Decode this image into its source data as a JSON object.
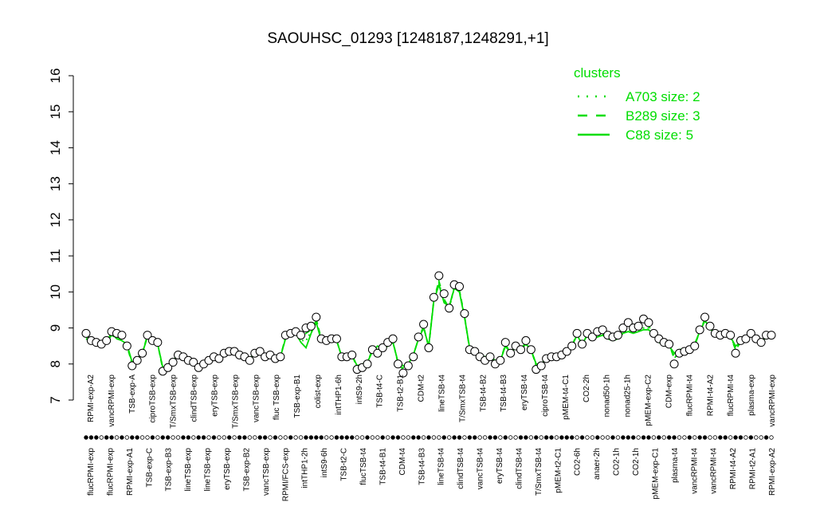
{
  "chart_data": {
    "type": "line",
    "title": "SAOUHSC_01293 [1248187,1248291,+1]",
    "ylim": [
      7,
      16
    ],
    "yticks": [
      "7",
      "8",
      "9",
      "10",
      "11",
      "12",
      "13",
      "14",
      "15",
      "16"
    ],
    "grid": false,
    "legend_position": "top-right",
    "legend": {
      "title": "clusters",
      "color": "#00dd00",
      "entries": [
        {
          "label": "A703 size: 2",
          "style": "dotted"
        },
        {
          "label": "B289 size: 3",
          "style": "dashed"
        },
        {
          "label": "C88 size: 5",
          "style": "solid"
        }
      ]
    },
    "x_labels_upper": [
      "RPMI-exp-A2",
      "vancRPMI-exp",
      "TSB-exp-A",
      "ciproTSB-exp",
      "T/SmxTSB-exp",
      "clindTSB-exp",
      "eryTSB-exp",
      "T/SmxTSB-exp",
      "vancTSB-exp",
      "fluc TSB-exp",
      "TSB-exp-B1",
      "colist-exp",
      "intTHP1-6h",
      "intS9-2h",
      "TSB-t4-C",
      "TSB-t2-B1",
      "CDM-t2",
      "lineTSB-t4",
      "T/SmxTSB-t4",
      "TSB-t4-B2",
      "TSB-t4-B3",
      "eryTSB-t4",
      "ciproTSB-t4",
      "pMEM-t4-C1",
      "CO2-2h",
      "nonad50-1h",
      "nonad25-1h",
      "pMEM-exp-C2",
      "CDM-exp",
      "flucRPMI-t4",
      "RPMI-t4-A2",
      "flucRPMI-t4",
      "plasma-exp",
      "vancRPMI-exp"
    ],
    "x_labels_lower": [
      "flucRPMI-exp",
      "flucRPMI-exp",
      "RPMI-exp-A1",
      "TSB-exp-C",
      "TSB-exp-B3",
      "lineTSB-exp",
      "lineTSB-exp",
      "eryTSB-exp",
      "TSB-exp-B2",
      "vancTSB-exp",
      "RPMI/FCS-exp",
      "intTHP1-2h",
      "intS9-6h",
      "TSB-t2-C",
      "flucTSB-t4",
      "TSB-t4-B1",
      "CDM-t4",
      "TSB-t4-B3",
      "lineTSB-t4",
      "clindTSB-t4",
      "vancTSB-t4",
      "eryTSB-t4",
      "clindTSB-t4",
      "T/SmxTSB-t4",
      "pMEM-t2-C1",
      "CO2-6h",
      "anaer-2h",
      "CO2-1h",
      "CO2-1h",
      "pMEM-exp-C1",
      "plasma-t4",
      "vancRPMI-t4",
      "vancRPMI-t4",
      "RPMI-t4-A2",
      "RPMI-t2-A1",
      "RPMI-exp-A2"
    ],
    "series": [
      {
        "style": "points",
        "values": [
          8.85,
          8.65,
          8.6,
          8.55,
          8.65,
          8.9,
          8.85,
          8.8,
          8.5,
          7.95,
          8.1,
          8.3,
          8.8,
          8.65,
          8.6,
          7.8,
          7.9,
          8.05,
          8.25,
          8.2,
          8.1,
          8.05,
          7.9,
          8.0,
          8.1,
          8.2,
          8.15,
          8.3,
          8.35,
          8.35,
          8.25,
          8.2,
          8.1,
          8.3,
          8.35,
          8.2,
          8.25,
          8.15,
          8.2,
          8.8,
          8.85,
          8.9,
          8.8,
          9.0,
          9.05,
          9.3,
          8.7,
          8.65,
          8.7,
          8.7,
          8.2,
          8.2,
          8.25,
          7.85,
          7.9,
          8.0,
          8.4,
          8.3,
          8.45,
          8.6,
          8.7,
          8.0,
          7.75,
          7.95,
          8.2,
          8.75,
          9.1,
          8.45,
          9.85,
          10.45,
          9.95,
          9.55,
          10.2,
          10.15,
          9.4,
          8.4,
          8.35,
          8.2,
          8.1,
          8.2,
          8.0,
          8.1,
          8.6,
          8.3,
          8.5,
          8.4,
          8.65,
          8.4,
          7.85,
          7.95,
          8.15,
          8.2,
          8.2,
          8.25,
          8.35,
          8.5,
          8.85,
          8.55,
          8.85,
          8.75,
          8.9,
          8.95,
          8.8,
          8.75,
          8.8,
          9.0,
          9.15,
          9.0,
          9.05,
          9.25,
          9.15,
          8.85,
          8.7,
          8.6,
          8.55,
          8.0,
          8.3,
          8.35,
          8.4,
          8.5,
          8.95,
          9.3,
          9.05,
          8.85,
          8.8,
          8.85,
          8.8,
          8.3,
          8.65,
          8.7,
          8.85,
          8.7,
          8.6,
          8.8,
          8.8
        ]
      },
      {
        "name": "C88 size: 5",
        "style": "solid",
        "values": [
          8.7,
          8.6,
          8.55,
          8.6,
          8.65,
          8.85,
          8.7,
          8.65,
          8.55,
          8.05,
          8.15,
          8.3,
          8.75,
          8.6,
          8.55,
          7.9,
          7.95,
          8.1,
          8.25,
          8.15,
          8.1,
          8.05,
          7.95,
          8.05,
          8.15,
          8.25,
          8.2,
          8.3,
          8.35,
          8.3,
          8.25,
          8.2,
          8.15,
          8.3,
          8.3,
          8.2,
          8.25,
          8.2,
          8.2,
          8.7,
          8.8,
          8.85,
          8.6,
          8.45,
          8.85,
          9.15,
          8.65,
          8.6,
          8.65,
          8.65,
          8.2,
          8.2,
          8.25,
          7.95,
          8.0,
          8.05,
          8.35,
          8.5,
          8.4,
          8.5,
          8.6,
          8.05,
          7.95,
          8.0,
          8.25,
          8.7,
          9.0,
          8.5,
          9.75,
          10.2,
          9.7,
          9.6,
          10.1,
          10.0,
          9.3,
          8.45,
          8.35,
          8.25,
          8.2,
          8.2,
          8.1,
          8.1,
          8.5,
          8.3,
          8.45,
          8.4,
          8.55,
          8.4,
          8.0,
          8.0,
          8.15,
          8.2,
          8.2,
          8.3,
          8.35,
          8.5,
          8.8,
          8.55,
          8.8,
          8.7,
          8.75,
          8.8,
          8.7,
          8.65,
          8.7,
          8.85,
          8.9,
          8.85,
          8.9,
          8.95,
          8.95,
          8.8,
          8.6,
          8.55,
          8.5,
          8.3,
          8.4,
          8.4,
          8.45,
          8.55,
          8.9,
          9.2,
          9.0,
          8.8,
          8.75,
          8.8,
          8.75,
          8.5,
          8.6,
          8.7,
          8.8,
          8.7,
          8.6,
          8.75,
          8.75
        ]
      },
      {
        "name": "B289 size: 3",
        "style": "dashed",
        "values": [
          8.8,
          8.65,
          8.6,
          8.55,
          8.6,
          8.8,
          8.75,
          8.7,
          8.5,
          8.0,
          8.1,
          8.3,
          8.8,
          8.65,
          8.55,
          7.85,
          7.95,
          8.1,
          8.25,
          8.2,
          8.1,
          8.05,
          7.95,
          8.05,
          8.1,
          8.2,
          8.2,
          8.3,
          8.35,
          8.3,
          8.25,
          8.2,
          8.15,
          8.3,
          8.3,
          8.2,
          8.25,
          8.2,
          8.2,
          8.75,
          8.8,
          8.85,
          8.7,
          8.85,
          8.95,
          9.25,
          8.7,
          8.6,
          8.65,
          8.65,
          8.2,
          8.2,
          8.25,
          7.9,
          7.95,
          8.05,
          8.4,
          8.4,
          8.45,
          8.55,
          8.65,
          8.0,
          7.85,
          7.95,
          8.25,
          8.7,
          9.05,
          8.45,
          9.8,
          10.3,
          9.8,
          9.55,
          10.15,
          10.05,
          9.35,
          8.4,
          8.35,
          8.2,
          8.15,
          8.2,
          8.05,
          8.1,
          8.55,
          8.3,
          8.5,
          8.4,
          8.6,
          8.4,
          7.95,
          7.95,
          8.15,
          8.2,
          8.2,
          8.25,
          8.35,
          8.5,
          8.85,
          8.55,
          8.8,
          8.75,
          8.85,
          8.9,
          8.75,
          8.7,
          8.75,
          8.95,
          9.05,
          8.95,
          9.0,
          9.1,
          9.05,
          8.85,
          8.65,
          8.6,
          8.55,
          8.15,
          8.35,
          8.35,
          8.4,
          8.5,
          8.9,
          9.25,
          9.0,
          8.85,
          8.75,
          8.8,
          8.75,
          8.4,
          8.6,
          8.7,
          8.8,
          8.7,
          8.6,
          8.75,
          8.8
        ]
      },
      {
        "name": "A703 size: 2",
        "style": "dotted",
        "values": [
          8.75,
          8.6,
          8.55,
          8.55,
          8.6,
          8.8,
          8.7,
          8.65,
          8.5,
          8.05,
          8.15,
          8.3,
          8.75,
          8.6,
          8.55,
          7.9,
          7.95,
          8.1,
          8.25,
          8.15,
          8.1,
          8.05,
          7.95,
          8.05,
          8.15,
          8.2,
          8.2,
          8.3,
          8.35,
          8.3,
          8.25,
          8.2,
          8.15,
          8.3,
          8.3,
          8.2,
          8.25,
          8.2,
          8.2,
          8.7,
          8.8,
          8.85,
          8.65,
          8.65,
          8.9,
          9.2,
          8.65,
          8.6,
          8.65,
          8.65,
          8.2,
          8.2,
          8.25,
          7.95,
          7.95,
          8.05,
          8.35,
          8.45,
          8.4,
          8.5,
          8.6,
          8.05,
          7.9,
          8.0,
          8.25,
          8.7,
          9.0,
          8.5,
          9.75,
          10.25,
          9.75,
          9.55,
          10.1,
          10.0,
          9.3,
          8.45,
          8.35,
          8.25,
          8.2,
          8.2,
          8.1,
          8.1,
          8.5,
          8.3,
          8.45,
          8.4,
          8.55,
          8.4,
          8.0,
          8.0,
          8.15,
          8.2,
          8.2,
          8.3,
          8.35,
          8.5,
          8.8,
          8.55,
          8.8,
          8.7,
          8.8,
          8.85,
          8.7,
          8.65,
          8.7,
          8.9,
          8.95,
          8.9,
          8.95,
          9.0,
          9.0,
          8.8,
          8.6,
          8.55,
          8.5,
          8.25,
          8.4,
          8.4,
          8.45,
          8.55,
          8.9,
          9.2,
          9.0,
          8.8,
          8.75,
          8.8,
          8.75,
          8.45,
          8.6,
          8.7,
          8.8,
          8.7,
          8.6,
          8.75,
          8.75
        ]
      }
    ]
  }
}
